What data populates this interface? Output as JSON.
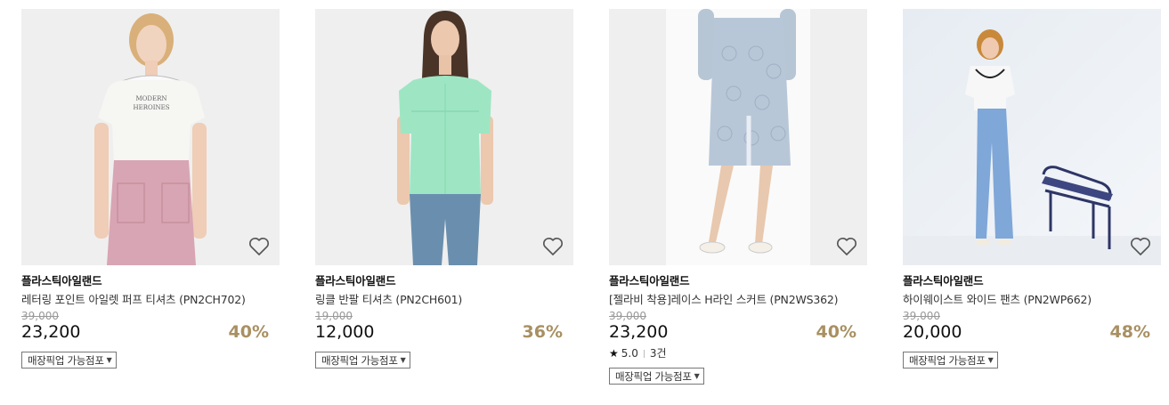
{
  "products": [
    {
      "brand": "플라스틱아일랜드",
      "title": "레터링 포인트 아일렛 퍼프 티셔츠 (PN2CH702)",
      "original_price": "39,000",
      "price": "23,200",
      "discount": "40%",
      "pickup_label": "매장픽업 가능점포",
      "image_text": [
        "MODERN",
        "HEROINES"
      ],
      "wishlist_icon": "heart-outline-icon"
    },
    {
      "brand": "플라스틱아일랜드",
      "title": "링클 반팔 티셔츠 (PN2CH601)",
      "original_price": "19,000",
      "price": "12,000",
      "discount": "36%",
      "pickup_label": "매장픽업 가능점포",
      "wishlist_icon": "heart-outline-icon"
    },
    {
      "brand": "플라스틱아일랜드",
      "title": "[젤라비 착용]레이스 H라인 스커트 (PN2WS362)",
      "original_price": "39,000",
      "price": "23,200",
      "discount": "40%",
      "rating": "5.0",
      "review_count": "3건",
      "pickup_label": "매장픽업 가능점포",
      "wishlist_icon": "heart-outline-icon"
    },
    {
      "brand": "플라스틱아일랜드",
      "title": "하이웨이스트 와이드 팬츠 (PN2WP662)",
      "original_price": "39,000",
      "price": "20,000",
      "discount": "48%",
      "pickup_label": "매장픽업 가능점포",
      "wishlist_icon": "heart-outline-icon"
    }
  ],
  "colors": {
    "discount": "#a99062",
    "strike_price": "#999999",
    "thumb_bg": "#efefef"
  }
}
